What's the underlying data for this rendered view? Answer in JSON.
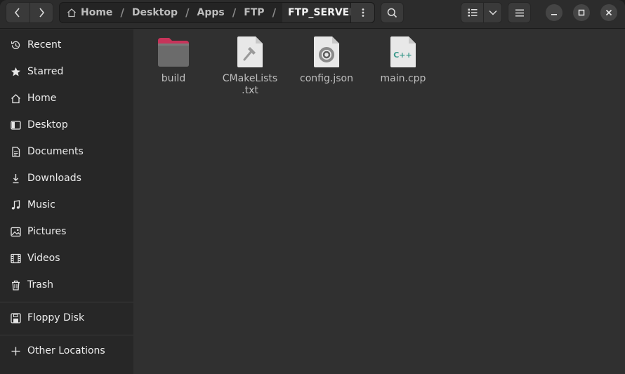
{
  "header": {
    "breadcrumbs": [
      {
        "label": "Home"
      },
      {
        "label": "Desktop"
      },
      {
        "label": "Apps"
      },
      {
        "label": "FTP"
      },
      {
        "label": "FTP_SERVER"
      }
    ],
    "separator": "/"
  },
  "sidebar": {
    "items": [
      {
        "label": "Recent",
        "icon": "clock-icon"
      },
      {
        "label": "Starred",
        "icon": "star-icon"
      },
      {
        "label": "Home",
        "icon": "home-icon"
      },
      {
        "label": "Desktop",
        "icon": "desktop-icon"
      },
      {
        "label": "Documents",
        "icon": "document-icon"
      },
      {
        "label": "Downloads",
        "icon": "download-icon"
      },
      {
        "label": "Music",
        "icon": "music-icon"
      },
      {
        "label": "Pictures",
        "icon": "picture-icon"
      },
      {
        "label": "Videos",
        "icon": "video-icon"
      },
      {
        "label": "Trash",
        "icon": "trash-icon"
      }
    ],
    "devices": [
      {
        "label": "Floppy Disk",
        "icon": "floppy-disk-icon"
      }
    ],
    "other": [
      {
        "label": "Other Locations",
        "icon": "plus-icon"
      }
    ]
  },
  "files": [
    {
      "name": "build",
      "type": "folder",
      "icon": "folder-icon"
    },
    {
      "name": "CMakeLists\n.txt",
      "type": "cmake",
      "icon": "cmake-file-icon"
    },
    {
      "name": "config.json",
      "type": "json",
      "icon": "json-file-icon"
    },
    {
      "name": "main.cpp",
      "type": "cpp",
      "icon": "cpp-file-icon",
      "badge": "C++"
    }
  ],
  "colors": {
    "window_bg": "#303030",
    "sidebar_bg": "#272727",
    "folder_accent": "#c7345a",
    "cpp_accent": "#3c9a8c"
  }
}
